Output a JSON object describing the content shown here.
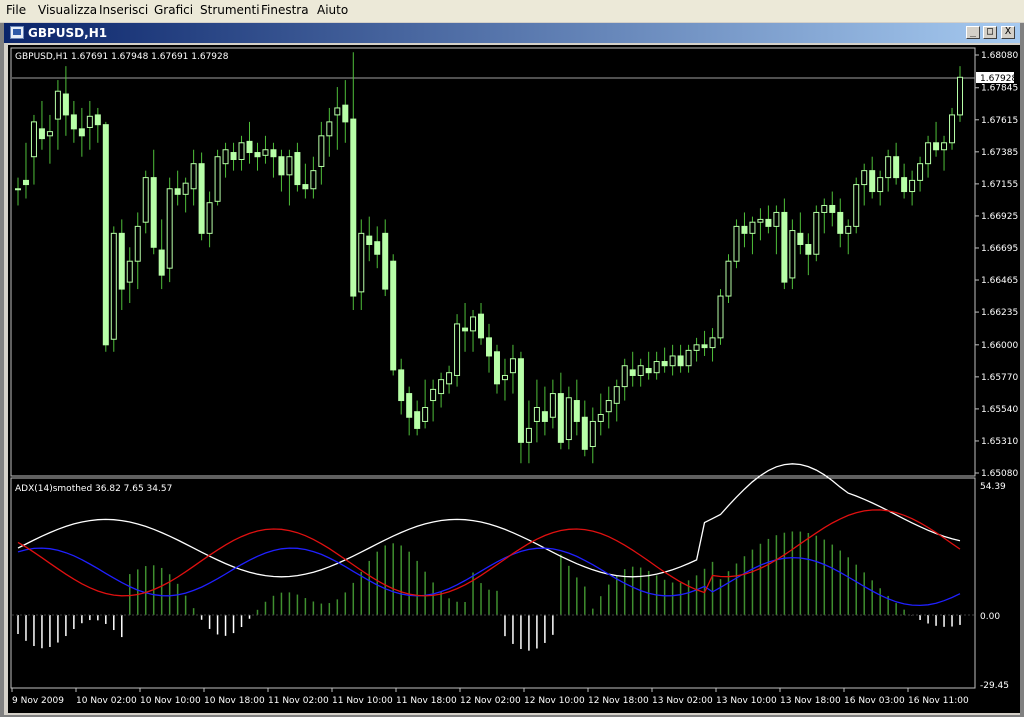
{
  "menu": [
    "File",
    "Visualizza",
    "Inserisci",
    "Grafici",
    "Strumenti",
    "Finestra",
    "Aiuto"
  ],
  "window": {
    "title": "GBPUSD,H1",
    "buttons": {
      "minimize": "_",
      "restore": "□",
      "close": "X"
    }
  },
  "main_panel": {
    "info": "GBPUSD,H1  1.67691 1.67948 1.67691 1.67928",
    "price_tag": "1.67928",
    "price_labels": [
      "1.68080",
      "1.67845",
      "1.67615",
      "1.67385",
      "1.67155",
      "1.66925",
      "1.66695",
      "1.66465",
      "1.66235",
      "1.66000",
      "1.65770",
      "1.65540",
      "1.65310",
      "1.65080"
    ]
  },
  "adx_panel": {
    "info": "ADX(14)smothed 36.82 7.65 34.57",
    "labels": [
      "54.39",
      "0.00",
      "-29.45"
    ]
  },
  "time_labels": [
    "9 Nov 2009",
    "10 Nov 02:00",
    "10 Nov 10:00",
    "10 Nov 18:00",
    "11 Nov 02:00",
    "11 Nov 10:00",
    "11 Nov 18:00",
    "12 Nov 02:00",
    "12 Nov 10:00",
    "12 Nov 18:00",
    "13 Nov 02:00",
    "13 Nov 10:00",
    "13 Nov 18:00",
    "16 Nov 03:00",
    "16 Nov 11:00"
  ],
  "colors": {
    "background": "#000000",
    "candle": "#b8ffa8",
    "wick": "#4fbf3a",
    "adx": "#ffffff",
    "plus_di": "#2020ff",
    "minus_di": "#e01010",
    "hist_pos": "#3f8f2f",
    "hist_neg": "#ffffff"
  },
  "chart_data": {
    "type": "candlestick",
    "symbol": "GBPUSD",
    "timeframe": "H1",
    "ylim": [
      1.6508,
      1.6808
    ],
    "ohlc": [
      [
        1.6712,
        1.672,
        1.67,
        1.6712
      ],
      [
        1.6718,
        1.6745,
        1.6705,
        1.6715
      ],
      [
        1.6735,
        1.6765,
        1.6715,
        1.676
      ],
      [
        1.6755,
        1.6775,
        1.674,
        1.6748
      ],
      [
        1.675,
        1.6765,
        1.673,
        1.6753
      ],
      [
        1.6762,
        1.679,
        1.674,
        1.6782
      ],
      [
        1.678,
        1.68,
        1.675,
        1.6765
      ],
      [
        1.6765,
        1.6775,
        1.6745,
        1.6755
      ],
      [
        1.6755,
        1.677,
        1.6735,
        1.675
      ],
      [
        1.6756,
        1.6775,
        1.674,
        1.6764
      ],
      [
        1.6765,
        1.677,
        1.6745,
        1.6758
      ],
      [
        1.6758,
        1.676,
        1.6595,
        1.66
      ],
      [
        1.6604,
        1.6685,
        1.6595,
        1.668
      ],
      [
        1.668,
        1.669,
        1.6625,
        1.664
      ],
      [
        1.6645,
        1.667,
        1.663,
        1.666
      ],
      [
        1.666,
        1.6695,
        1.664,
        1.6685
      ],
      [
        1.6688,
        1.6725,
        1.668,
        1.672
      ],
      [
        1.672,
        1.674,
        1.6665,
        1.667
      ],
      [
        1.6668,
        1.669,
        1.664,
        1.665
      ],
      [
        1.6655,
        1.672,
        1.6645,
        1.6712
      ],
      [
        1.6712,
        1.6725,
        1.67,
        1.6708
      ],
      [
        1.6708,
        1.672,
        1.6695,
        1.6716
      ],
      [
        1.6712,
        1.674,
        1.67,
        1.673
      ],
      [
        1.673,
        1.6738,
        1.6675,
        1.668
      ],
      [
        1.668,
        1.671,
        1.667,
        1.6702
      ],
      [
        1.6703,
        1.674,
        1.67,
        1.6735
      ],
      [
        1.673,
        1.6745,
        1.672,
        1.674
      ],
      [
        1.6738,
        1.6745,
        1.6725,
        1.6733
      ],
      [
        1.6733,
        1.675,
        1.6725,
        1.6745
      ],
      [
        1.6746,
        1.676,
        1.673,
        1.6738
      ],
      [
        1.6738,
        1.6745,
        1.6725,
        1.6735
      ],
      [
        1.6736,
        1.675,
        1.673,
        1.674
      ],
      [
        1.674,
        1.6745,
        1.672,
        1.6735
      ],
      [
        1.6735,
        1.674,
        1.671,
        1.6722
      ],
      [
        1.6722,
        1.674,
        1.67,
        1.6735
      ],
      [
        1.6738,
        1.6745,
        1.671,
        1.6715
      ],
      [
        1.6715,
        1.673,
        1.6705,
        1.6712
      ],
      [
        1.6712,
        1.6735,
        1.6705,
        1.6725
      ],
      [
        1.6728,
        1.676,
        1.6715,
        1.675
      ],
      [
        1.675,
        1.677,
        1.6735,
        1.676
      ],
      [
        1.6765,
        1.6785,
        1.674,
        1.677
      ],
      [
        1.6772,
        1.679,
        1.6745,
        1.676
      ],
      [
        1.6762,
        1.681,
        1.6625,
        1.6635
      ],
      [
        1.6638,
        1.669,
        1.6625,
        1.668
      ],
      [
        1.6678,
        1.6692,
        1.666,
        1.6672
      ],
      [
        1.6674,
        1.6685,
        1.6655,
        1.6665
      ],
      [
        1.668,
        1.669,
        1.6635,
        1.664
      ],
      [
        1.666,
        1.6665,
        1.6578,
        1.6582
      ],
      [
        1.6582,
        1.659,
        1.655,
        1.656
      ],
      [
        1.6565,
        1.657,
        1.6535,
        1.6548
      ],
      [
        1.6552,
        1.656,
        1.6535,
        1.654
      ],
      [
        1.6545,
        1.6575,
        1.654,
        1.6555
      ],
      [
        1.656,
        1.6575,
        1.6545,
        1.6568
      ],
      [
        1.6565,
        1.658,
        1.6555,
        1.6575
      ],
      [
        1.6572,
        1.6585,
        1.6565,
        1.658
      ],
      [
        1.6578,
        1.6622,
        1.657,
        1.6615
      ],
      [
        1.6612,
        1.663,
        1.6595,
        1.661
      ],
      [
        1.661,
        1.6625,
        1.6595,
        1.662
      ],
      [
        1.6622,
        1.663,
        1.66,
        1.6605
      ],
      [
        1.6605,
        1.6615,
        1.658,
        1.6592
      ],
      [
        1.6595,
        1.66,
        1.6565,
        1.6572
      ],
      [
        1.6575,
        1.659,
        1.656,
        1.6578
      ],
      [
        1.658,
        1.66,
        1.6565,
        1.659
      ],
      [
        1.659,
        1.6595,
        1.6515,
        1.653
      ],
      [
        1.653,
        1.656,
        1.6515,
        1.654
      ],
      [
        1.6545,
        1.6575,
        1.653,
        1.6555
      ],
      [
        1.6552,
        1.657,
        1.6535,
        1.6545
      ],
      [
        1.6548,
        1.6575,
        1.654,
        1.6565
      ],
      [
        1.6565,
        1.658,
        1.6525,
        1.653
      ],
      [
        1.6532,
        1.657,
        1.6525,
        1.6562
      ],
      [
        1.656,
        1.6575,
        1.6535,
        1.6545
      ],
      [
        1.6548,
        1.656,
        1.652,
        1.6525
      ],
      [
        1.6527,
        1.6555,
        1.6515,
        1.6545
      ],
      [
        1.6545,
        1.6565,
        1.6535,
        1.655
      ],
      [
        1.6552,
        1.657,
        1.654,
        1.656
      ],
      [
        1.6558,
        1.6575,
        1.6545,
        1.657
      ],
      [
        1.657,
        1.659,
        1.656,
        1.6585
      ],
      [
        1.6582,
        1.6595,
        1.657,
        1.6578
      ],
      [
        1.6578,
        1.659,
        1.657,
        1.6585
      ],
      [
        1.6583,
        1.6595,
        1.6575,
        1.658
      ],
      [
        1.658,
        1.6595,
        1.6575,
        1.6588
      ],
      [
        1.6588,
        1.6598,
        1.658,
        1.6585
      ],
      [
        1.6585,
        1.66,
        1.6578,
        1.6592
      ],
      [
        1.6592,
        1.66,
        1.658,
        1.6585
      ],
      [
        1.6585,
        1.66,
        1.658,
        1.6596
      ],
      [
        1.6596,
        1.6605,
        1.6588,
        1.66
      ],
      [
        1.66,
        1.661,
        1.6592,
        1.6598
      ],
      [
        1.6598,
        1.6612,
        1.6588,
        1.6605
      ],
      [
        1.6605,
        1.664,
        1.66,
        1.6635
      ],
      [
        1.6635,
        1.6665,
        1.663,
        1.666
      ],
      [
        1.666,
        1.669,
        1.6655,
        1.6685
      ],
      [
        1.6685,
        1.6695,
        1.667,
        1.668
      ],
      [
        1.668,
        1.6692,
        1.6665,
        1.6688
      ],
      [
        1.6688,
        1.6698,
        1.6675,
        1.669
      ],
      [
        1.669,
        1.67,
        1.668,
        1.6685
      ],
      [
        1.6685,
        1.67,
        1.6665,
        1.6695
      ],
      [
        1.6695,
        1.6705,
        1.664,
        1.6645
      ],
      [
        1.6648,
        1.669,
        1.664,
        1.6682
      ],
      [
        1.668,
        1.6695,
        1.6665,
        1.6672
      ],
      [
        1.6672,
        1.668,
        1.665,
        1.6665
      ],
      [
        1.6665,
        1.67,
        1.666,
        1.6695
      ],
      [
        1.6695,
        1.6705,
        1.668,
        1.67
      ],
      [
        1.67,
        1.671,
        1.6685,
        1.6695
      ],
      [
        1.6695,
        1.6705,
        1.667,
        1.668
      ],
      [
        1.668,
        1.669,
        1.6665,
        1.6685
      ],
      [
        1.6685,
        1.672,
        1.668,
        1.6715
      ],
      [
        1.6715,
        1.673,
        1.67,
        1.6725
      ],
      [
        1.6725,
        1.6735,
        1.6705,
        1.671
      ],
      [
        1.671,
        1.6725,
        1.67,
        1.672
      ],
      [
        1.672,
        1.674,
        1.671,
        1.6735
      ],
      [
        1.6735,
        1.6745,
        1.6715,
        1.672
      ],
      [
        1.672,
        1.673,
        1.6705,
        1.671
      ],
      [
        1.671,
        1.6725,
        1.67,
        1.6718
      ],
      [
        1.6718,
        1.6735,
        1.671,
        1.673
      ],
      [
        1.673,
        1.675,
        1.672,
        1.6745
      ],
      [
        1.6745,
        1.676,
        1.6735,
        1.674
      ],
      [
        1.674,
        1.675,
        1.6725,
        1.6745
      ],
      [
        1.6745,
        1.677,
        1.674,
        1.6765
      ],
      [
        1.6765,
        1.68,
        1.676,
        1.6792
      ]
    ]
  }
}
